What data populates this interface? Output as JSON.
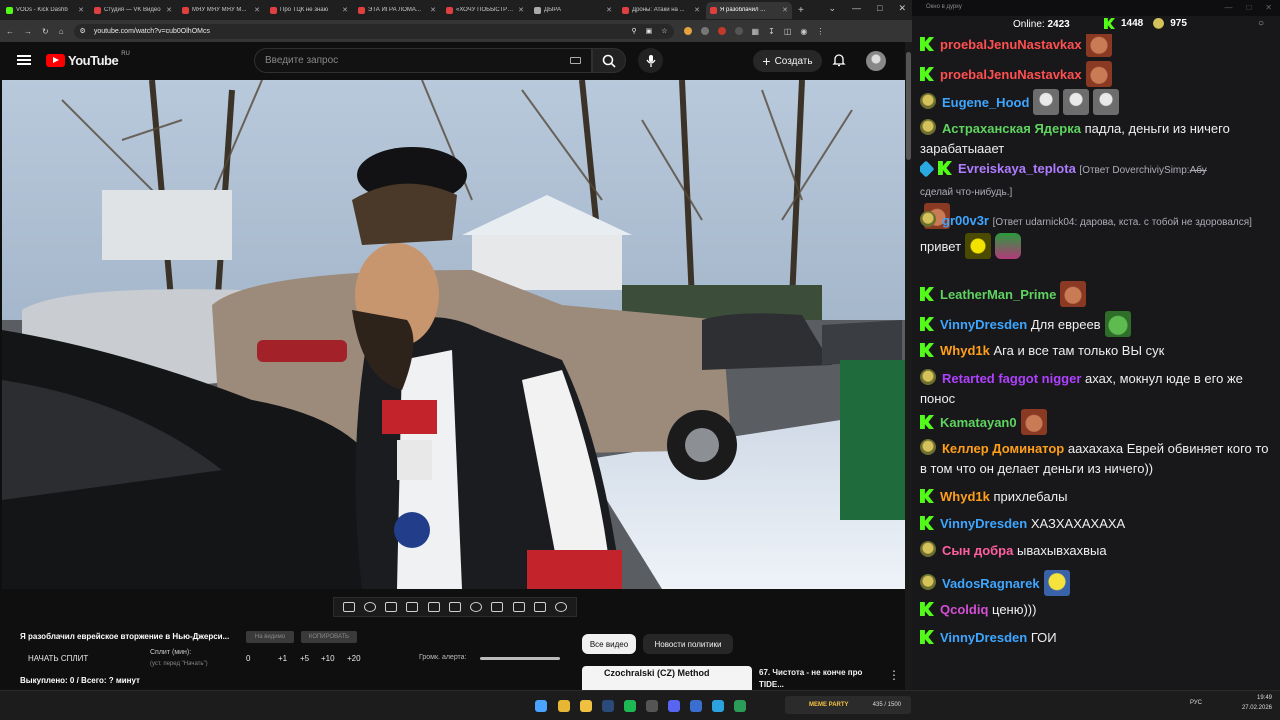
{
  "browser": {
    "tabs": [
      {
        "label": "VODs - Kick Dashb",
        "color": "#53fc18",
        "active": false
      },
      {
        "label": "Студия — VK Видео",
        "color": "#e03f3f",
        "active": false
      },
      {
        "label": "МЯУ МЯУ МЯУ М...",
        "color": "#e03f3f",
        "active": false
      },
      {
        "label": "Про ТЦК не знаю",
        "color": "#e03f3f",
        "active": false
      },
      {
        "label": "ЭТА ИГРА ЛОМА...",
        "color": "#e03f3f",
        "active": false
      },
      {
        "label": "«ХОЧУ ПОБЫСТРЕ...",
        "color": "#e03f3f",
        "active": false
      },
      {
        "label": "ДЫРА",
        "color": "#aaaaaa",
        "active": false
      },
      {
        "label": "Дроны: Атаки на ...",
        "color": "#e03f3f",
        "active": false
      },
      {
        "label": "Я разоблачил ...",
        "color": "#e03f3f",
        "active": true
      }
    ],
    "url": "youtube.com/watch?v=cub0OlhOMcs"
  },
  "youtube": {
    "logo_text": "YouTube",
    "logo_region": "RU",
    "search_placeholder": "Введите запрос",
    "create_label": "Создать"
  },
  "player": {
    "video_title": "Я разоблачил еврейское вторжение в Нью-Джерси...",
    "btn_hide": "На видимо",
    "btn_copy": "КОПИРОВАТЬ",
    "start_split": "НАЧАТЬ СПЛИТ",
    "split_min": "Сплит (мин):",
    "split_sub": "(уст. перед \"Начать\")",
    "split_value": "0",
    "increments": [
      "+1",
      "+5",
      "+10",
      "+20"
    ],
    "alert_volume": "Громк. алерта:",
    "bought": "Выкуплено: 0 / Всего: ? минут"
  },
  "related": {
    "chips": [
      "Все видео",
      "Новости политики"
    ],
    "thumb_title": "Czochralski (CZ) Method",
    "video_title": "67. Чистота - не конче про TIDE..."
  },
  "chat": {
    "window_title": "Окно в дурку",
    "online_label": "Online:",
    "online": "2423",
    "kick_count": "1448",
    "other_count": "975",
    "messages": [
      {
        "user": "proebalJenuNastavkax",
        "color": "#ff4f4f",
        "badge": "k",
        "text": "",
        "emotes": [
          "face"
        ]
      },
      {
        "user": "proebalJenuNastavkax",
        "color": "#ff4f4f",
        "badge": "k",
        "text": "",
        "emotes": [
          "face"
        ]
      },
      {
        "user": "Eugene_Hood",
        "color": "#3ea6ff",
        "badge": "s",
        "text": "",
        "emotes": [
          "ghost",
          "ghost",
          "ghost"
        ]
      },
      {
        "user": "Астраханская Ядерка",
        "color": "#5fd35f",
        "badge": "s",
        "text": "падла, деньги из ничего зарабатыаает",
        "emotes": []
      },
      {
        "user": "Evreiskaya_teplota",
        "color": "#b07cff",
        "badge": "pk",
        "reply": "[Ответ DoverchiviySimp:",
        "reply_strike": "Абу",
        "reply2": "сделай что-нибудь.]",
        "text": "",
        "emotes": [
          "face"
        ]
      },
      {
        "user": "gr00v3r",
        "color": "#3ea6ff",
        "badge": "s",
        "reply": "[Ответ udarnick04: дарова, кста. с тобой не здоровался]",
        "text": "привет",
        "emotes": [
          "thumb",
          "hat"
        ]
      },
      {
        "user": "LeatherMan_Prime",
        "color": "#5fd35f",
        "badge": "k",
        "text": "",
        "emotes": [
          "face"
        ]
      },
      {
        "user": "VinnyDresden",
        "color": "#3ea6ff",
        "badge": "k",
        "text": "Для евреев",
        "emotes": [
          "frog"
        ]
      },
      {
        "user": "Whyd1k",
        "color": "#ff9f1a",
        "badge": "k",
        "text": "Ага и все там только ВЫ сук",
        "emotes": []
      },
      {
        "user": "Retarted faggot nigger",
        "color": "#b040ff",
        "badge": "s",
        "text": "ахах, мокнул юде в его же понос",
        "emotes": []
      },
      {
        "user": "Kamatayan0",
        "color": "#5fd35f",
        "badge": "k",
        "text": "",
        "emotes": [
          "face"
        ]
      },
      {
        "user": "Келлер Доминатор",
        "color": "#ff9f1a",
        "badge": "s",
        "text": "аахахаха Еврей обвиняет кого то в том что он делает деньги из ничего))",
        "emotes": []
      },
      {
        "user": "Whyd1k",
        "color": "#ff9f1a",
        "badge": "k",
        "text": "прихлебалы",
        "emotes": []
      },
      {
        "user": "VinnyDresden",
        "color": "#3ea6ff",
        "badge": "k",
        "text": "ХАЗХАХАХАХА",
        "emotes": []
      },
      {
        "user": "Сын добра",
        "color": "#ff5fa0",
        "badge": "s",
        "text": "ывахывхахвыа",
        "emotes": []
      },
      {
        "user": "VadosRagnarek",
        "color": "#3ea6ff",
        "badge": "s",
        "text": "",
        "emotes": [
          "minion"
        ]
      },
      {
        "user": "Qcoldiq",
        "color": "#d34fd3",
        "badge": "k",
        "text": "ценю)))",
        "emotes": []
      },
      {
        "user": "VinnyDresden",
        "color": "#3ea6ff",
        "badge": "k",
        "text": "ГОИ",
        "emotes": []
      }
    ]
  },
  "taskbar": {
    "meme_label": "MEME PARTY",
    "meme_counter": "435 / 1500",
    "lang": "РУС",
    "time": "19:49",
    "date": "27.02.2026"
  }
}
